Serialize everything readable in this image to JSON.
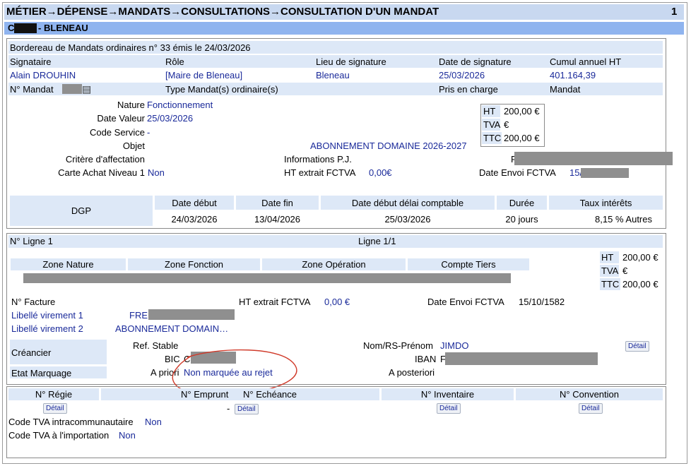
{
  "title": {
    "text": "MÉTIER→DÉPENSE→MANDATS→CONSULTATIONS→CONSULTATION D'UN MANDAT",
    "page": "1"
  },
  "subtitle": {
    "prefix": "C",
    "name": "- BLENEAU"
  },
  "bordereau": {
    "text": "Bordereau de Mandats ordinaires  n° 33  émis le  24/03/2026"
  },
  "signature": {
    "headers": [
      "Signataire",
      "Rôle",
      "Lieu de signature",
      "Date de signature",
      "Cumul annuel HT"
    ],
    "values": [
      "Alain DROUHIN",
      "[Maire de Bleneau]",
      "Bleneau",
      "25/03/2026",
      "401.164,39"
    ]
  },
  "mandat_row": {
    "num_label": "N° Mandat",
    "type_label": "Type Mandat(s) ordinaire(s)",
    "pris_label": "Pris en charge",
    "pris_value": "Mandat"
  },
  "details": {
    "nature_label": "Nature",
    "nature_value": "Fonctionnement",
    "date_valeur_label": "Date Valeur",
    "date_valeur_value": "25/03/2026",
    "code_service_label": "Code Service",
    "code_service_value": "-",
    "objet_label": "Objet",
    "objet_value": "ABONNEMENT DOMAINE 2026-2027",
    "critere_label": "Critère d'affectation",
    "carte_label": "Carte Achat Niveau 1",
    "carte_value": "Non",
    "infos_pj_label": "Informations P.J.",
    "ht_fctva_label": "HT extrait FCTVA",
    "ht_fctva_value": "0,00€",
    "date_envoi_label": "Date Envoi FCTVA",
    "date_envoi_value": "15/"
  },
  "totals1": {
    "ht_label": "HT",
    "ht_value": "200,00 €",
    "tva_label": "TVA",
    "tva_value": "€",
    "ttc_label": "TTC",
    "ttc_value": "200,00 €"
  },
  "dgp": {
    "label": "DGP",
    "headers": [
      "Date début",
      "Date fin",
      "Date début délai comptable",
      "Durée",
      "Taux intérêts"
    ],
    "values": [
      "24/03/2026",
      "13/04/2026",
      "25/03/2026",
      "20 jours",
      "8,15 % Autres"
    ]
  },
  "ligne": {
    "num": "N° Ligne 1",
    "count": "Ligne 1/1",
    "headers": [
      "Zone Nature",
      "Zone Fonction",
      "Zone Opération",
      "Compte Tiers"
    ],
    "facture_label": "N° Facture",
    "ht_fctva_label": "HT extrait FCTVA",
    "ht_fctva_value": "0,00 €",
    "date_envoi_label": "Date Envoi FCTVA",
    "date_envoi_value": "15/10/1582",
    "libelle1_label": "Libellé virement 1",
    "libelle1_value": "FRE",
    "libelle2_label": "Libellé virement 2",
    "libelle2_value": "ABONNEMENT DOMAIN…",
    "creancier_label": "Créancier",
    "ref_stable_label": "Ref. Stable",
    "nom_label": "Nom/RS-Prénom",
    "nom_value": "JIMDO",
    "bic_label": "BIC",
    "bic_value": "C",
    "iban_label": "IBAN",
    "iban_value": "F",
    "detail_label": "Détail",
    "etat_label": "Etat Marquage",
    "apriori_label": "A priori",
    "apriori_value": "Non marquée au rejet",
    "aposteriori_label": "A posteriori"
  },
  "totals2": {
    "ht_label": "HT",
    "ht_value": "200,00 €",
    "tva_label": "TVA",
    "tva_value": "€",
    "ttc_label": "TTC",
    "ttc_value": "200,00 €"
  },
  "bottom": {
    "headers": [
      "N° Régie",
      "N° Emprunt",
      "N° Echéance",
      "N° Inventaire",
      "N° Convention"
    ],
    "dash": "-",
    "detail_label": "Détail",
    "tva_intra_label": "Code TVA intracommunautaire",
    "tva_intra_value": "Non",
    "tva_import_label": "Code TVA à l'importation",
    "tva_import_value": "Non"
  },
  "colors": {
    "header_bg": "#dde8f7",
    "title_bg": "#c8d8f0",
    "subtitle_bg": "#8fb4ef",
    "value": "#1a2a9a",
    "annotation": "#d03a2a"
  }
}
